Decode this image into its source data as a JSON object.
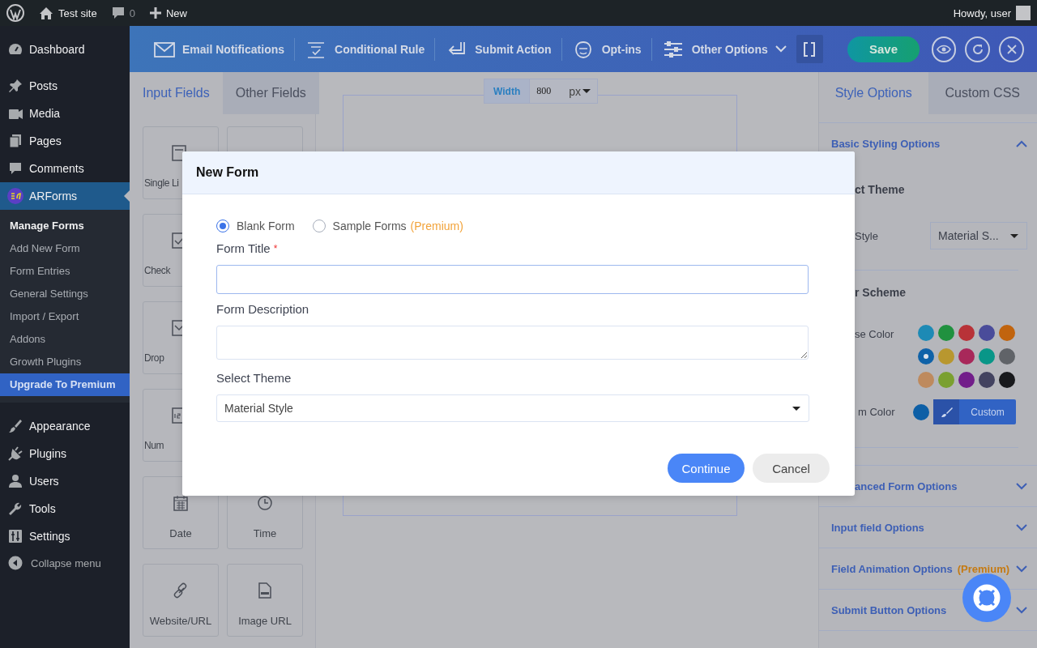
{
  "admin_bar": {
    "site_name": "Test site",
    "comment_count": "0",
    "new_label": "New",
    "greeting": "Howdy, user"
  },
  "sidebar": {
    "items": [
      {
        "label": "Dashboard",
        "current": false
      },
      {
        "label": "Posts",
        "current": false
      },
      {
        "label": "Media",
        "current": false
      },
      {
        "label": "Pages",
        "current": false
      },
      {
        "label": "Comments",
        "current": false
      },
      {
        "label": "ARForms",
        "current": true,
        "submenu": [
          {
            "label": "Manage Forms",
            "selected": true,
            "highlighted": false
          },
          {
            "label": "Add New Form",
            "selected": false,
            "highlighted": false
          },
          {
            "label": "Form Entries",
            "selected": false,
            "highlighted": false
          },
          {
            "label": "General Settings",
            "selected": false,
            "highlighted": false
          },
          {
            "label": "Import / Export",
            "selected": false,
            "highlighted": false
          },
          {
            "label": "Addons",
            "selected": false,
            "highlighted": false
          },
          {
            "label": "Growth Plugins",
            "selected": false,
            "highlighted": false
          },
          {
            "label": "Upgrade To Premium",
            "selected": false,
            "highlighted": true
          }
        ]
      },
      {
        "label": "Appearance",
        "current": false
      },
      {
        "label": "Plugins",
        "current": false
      },
      {
        "label": "Users",
        "current": false
      },
      {
        "label": "Tools",
        "current": false
      },
      {
        "label": "Settings",
        "current": false
      }
    ],
    "collapse_label": "Collapse menu"
  },
  "toolbar": {
    "items": [
      {
        "label": "Email Notifications",
        "has_menu": false
      },
      {
        "label": "Conditional Rule",
        "has_menu": false
      },
      {
        "label": "Submit Action",
        "has_menu": false
      },
      {
        "label": "Opt-ins",
        "has_menu": false
      },
      {
        "label": "Other Options",
        "has_menu": true
      }
    ],
    "save_label": "Save"
  },
  "left_panel": {
    "tabs": [
      {
        "label": "Input Fields",
        "selected": true
      },
      {
        "label": "Other Fields",
        "selected": false
      }
    ],
    "fields": [
      {
        "kind": "clipped",
        "label": "Single Li"
      },
      {
        "kind": "covered"
      },
      {
        "kind": "clipped",
        "label": "Check"
      },
      {
        "kind": "clipped",
        "label": "Drop"
      },
      {
        "kind": "clipped",
        "label": "Num"
      },
      {
        "kind": "field",
        "label": "Date"
      },
      {
        "kind": "field",
        "label": "Time"
      },
      {
        "kind": "field",
        "label": "Website/URL"
      },
      {
        "kind": "field",
        "label": "Image URL"
      }
    ]
  },
  "canvas": {
    "width_label": "Width",
    "width_value": "800",
    "width_unit": "px"
  },
  "modal": {
    "title": "New Form",
    "options": [
      {
        "label": "Blank Form",
        "selected": true
      },
      {
        "label": "Sample Forms",
        "selected": false,
        "note": "(Premium)"
      }
    ],
    "title_label": "Form Title",
    "required_mark": "*",
    "description_label": "Form Description",
    "theme_label": "Select Theme",
    "theme_value": "Material Style",
    "buttons": [
      {
        "label": "Continue",
        "kind": "primary"
      },
      {
        "label": "Cancel",
        "kind": "secondary"
      }
    ]
  },
  "right_panel": {
    "tabs": [
      {
        "label": "Style Options",
        "selected": true
      },
      {
        "label": "Custom CSS",
        "selected": false
      }
    ],
    "basic": {
      "title": "Basic Styling Options",
      "expanded": true,
      "theme_heading": "ct Theme",
      "style_label": "Style",
      "style_value": "Material S...",
      "scheme_heading": "r Scheme",
      "choose_label": "se Color",
      "colors": [
        {
          "color": "#1d8ab5",
          "selected": false
        },
        {
          "color": "#20913f",
          "selected": false
        },
        {
          "color": "#b83238",
          "selected": false
        },
        {
          "color": "#4a4c9a",
          "selected": false
        },
        {
          "color": "#c1640e",
          "selected": false
        },
        {
          "color": "#0f62a8",
          "selected": true
        },
        {
          "color": "#b8972f",
          "selected": false
        },
        {
          "color": "#a8285a",
          "selected": false
        },
        {
          "color": "#099688",
          "selected": false
        },
        {
          "color": "#606368",
          "selected": false
        },
        {
          "color": "#be8a5e",
          "selected": false
        },
        {
          "color": "#7aa030",
          "selected": false
        },
        {
          "color": "#721e8a",
          "selected": false
        },
        {
          "color": "#434360",
          "selected": false
        },
        {
          "color": "#18191c",
          "selected": false
        }
      ],
      "custom_label": "m Color",
      "custom_swatch": {
        "color": "#0d5fa6"
      },
      "custom_button": "Custom"
    },
    "sections": [
      {
        "title": "anced Form Options",
        "expanded": false,
        "clipped": true
      },
      {
        "title": "Input field Options",
        "expanded": false,
        "clipped": false
      },
      {
        "title": "Field Animation Options",
        "expanded": false,
        "clipped": false,
        "note": "(Premium)"
      },
      {
        "title": "Submit Button Options",
        "expanded": false,
        "clipped": false
      }
    ]
  }
}
